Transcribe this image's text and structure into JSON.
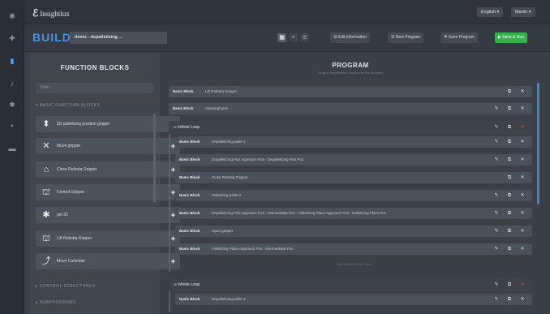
{
  "rail": {
    "icons": [
      "home-icon",
      "plus-icon",
      "build-icon",
      "robot-icon",
      "settings-icon",
      "menu-icon",
      "list-icon"
    ]
  },
  "topbar": {
    "logo_text": "Insightlux",
    "language": "English ▾",
    "user": "Martin ▾"
  },
  "buildbar": {
    "title": "BUILD",
    "program_name": "demo - depalletizing ...",
    "view_icons": [
      "grid-icon",
      "list-icon",
      "code-icon"
    ],
    "buttons": {
      "edit_info": "⚙ Edit Information",
      "new_program": "☰ New Program",
      "save_program": "⚑ Save Program",
      "save_run": "▶ Save & Run"
    }
  },
  "function_blocks": {
    "title": "FUNCTION BLOCKS",
    "search_placeholder": "Filter...",
    "section_basic": "▾ BASIC FUNCTION BLOCKS",
    "items": [
      {
        "label": "3D palletizing position gripper",
        "icon": "gripper-icon",
        "glyph": "⬍"
      },
      {
        "label": "Move gripper",
        "icon": "cross-icon",
        "glyph": "✕"
      },
      {
        "label": "Close Robotiq Gripper",
        "icon": "gripper-close-icon",
        "glyph": "⌂"
      },
      {
        "label": "Control Gripper",
        "icon": "gripper-control-icon",
        "glyph": "⛫"
      },
      {
        "label": "get IO",
        "icon": "io-icon",
        "glyph": "✱"
      },
      {
        "label": "Lift Robotiq Gripper",
        "icon": "gripper-lift-icon",
        "glyph": "⛫"
      },
      {
        "label": "Move Cartesian",
        "icon": "cartesian-icon",
        "glyph": "⤴"
      }
    ],
    "section_control": "▸ CONTROL STRUCTURES",
    "section_subprograms": "▸ SUBPROGRAMS"
  },
  "program": {
    "title": "PROGRAM",
    "subtitle": "Drag & drop function blocks into the program",
    "basic_tag": "Basic Block",
    "loop_label": "∞ Infinite Loop",
    "drop_hint": "Drop function block here",
    "rows_top": [
      {
        "text": "Lift Robotiq Gripper"
      },
      {
        "text": "Opening/open"
      }
    ],
    "loop1_rows": [
      {
        "text": "Depalletizing pallet 1"
      },
      {
        "text": "Depalletizing Pick Approach Pos - Depalletizing Pick Pos"
      },
      {
        "text": "Close Robotiq Gripper"
      },
      {
        "text": "Palletizing pallet 2"
      },
      {
        "text": "Depalletizing Pick Approach Pos - Intermediate Pos - Palletizing Place Approach Pos - Palletizing Place Pos"
      },
      {
        "text": "Open gripper"
      },
      {
        "text": "Palletizing Place Approach Pos - Intermediate Pos"
      }
    ],
    "loop2_rows": [
      {
        "text": "Depalletizing pallet 3"
      }
    ]
  }
}
